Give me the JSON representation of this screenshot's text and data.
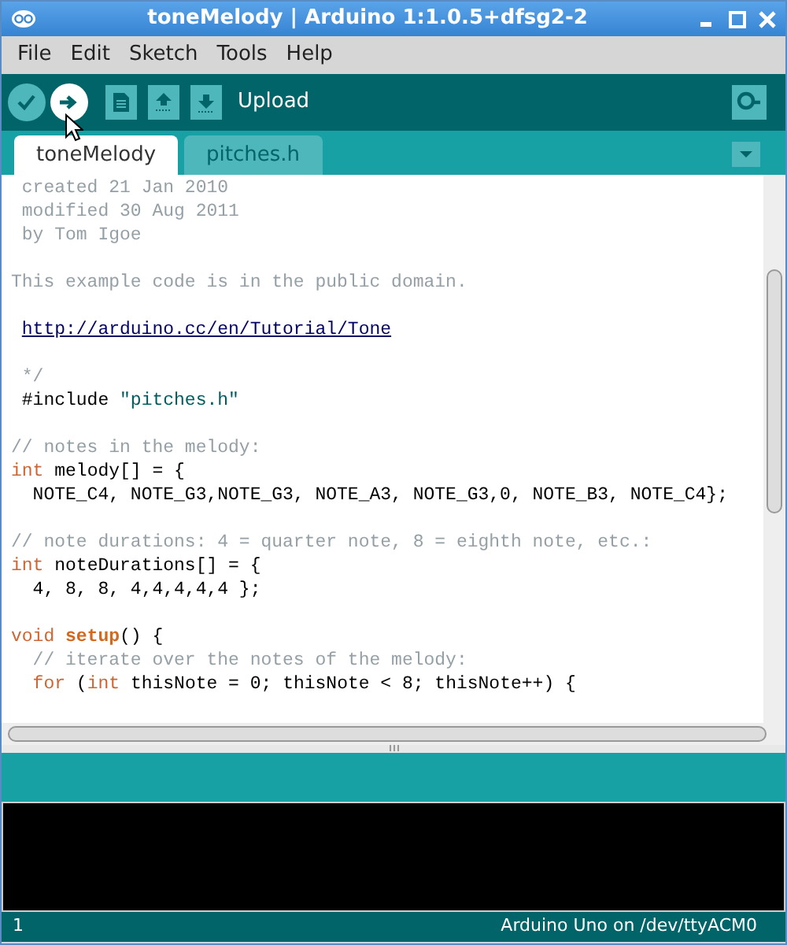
{
  "window": {
    "title": "toneMelody | Arduino 1:1.0.5+dfsg2-2"
  },
  "menu": [
    "File",
    "Edit",
    "Sketch",
    "Tools",
    "Help"
  ],
  "toolbar": {
    "buttons": [
      {
        "kind": "verify",
        "highlighted": false
      },
      {
        "kind": "upload",
        "highlighted": true
      },
      {
        "kind": "new",
        "highlighted": false
      },
      {
        "kind": "open",
        "highlighted": false
      },
      {
        "kind": "save",
        "highlighted": false
      }
    ],
    "hint": "Upload"
  },
  "tabs": [
    {
      "label": "toneMelody",
      "selected": true
    },
    {
      "label": "pitches.h",
      "selected": false
    }
  ],
  "editor": {
    "lines": [
      {
        "kind": "code",
        "tokens": [
          {
            "kind": "comment",
            "text": " created 21 Jan 2010"
          }
        ]
      },
      {
        "kind": "code",
        "tokens": [
          {
            "kind": "comment",
            "text": " modified 30 Aug 2011"
          }
        ]
      },
      {
        "kind": "code",
        "tokens": [
          {
            "kind": "comment",
            "text": " by Tom Igoe"
          }
        ]
      },
      {
        "kind": "blank"
      },
      {
        "kind": "code",
        "tokens": [
          {
            "kind": "comment",
            "text": "This example code is in the public domain."
          }
        ]
      },
      {
        "kind": "blank"
      },
      {
        "kind": "code",
        "tokens": [
          {
            "kind": "link",
            "text": "http://arduino.cc/en/Tutorial/Tone"
          }
        ]
      },
      {
        "kind": "blank"
      },
      {
        "kind": "code",
        "tokens": [
          {
            "kind": "comment",
            "text": " */"
          }
        ]
      },
      {
        "kind": "code",
        "tokens": [
          {
            "kind": "plain",
            "text": " #include "
          },
          {
            "kind": "string",
            "text": "\"pitches.h\""
          }
        ]
      },
      {
        "kind": "blank"
      },
      {
        "kind": "code",
        "tokens": [
          {
            "kind": "comment",
            "text": "// notes in the melody:"
          }
        ]
      },
      {
        "kind": "code",
        "tokens": [
          {
            "kind": "keyword",
            "text": "int"
          },
          {
            "kind": "plain",
            "text": " melody[] = {"
          }
        ]
      },
      {
        "kind": "code",
        "tokens": [
          {
            "kind": "plain",
            "text": "  NOTE_C4, NOTE_G3,NOTE_G3, NOTE_A3, NOTE_G3,0, NOTE_B3, NOTE_C4};"
          }
        ]
      },
      {
        "kind": "blank"
      },
      {
        "kind": "code",
        "tokens": [
          {
            "kind": "comment",
            "text": "// note durations: 4 = quarter note, 8 = eighth note, etc.:"
          }
        ]
      },
      {
        "kind": "code",
        "tokens": [
          {
            "kind": "keyword",
            "text": "int"
          },
          {
            "kind": "plain",
            "text": " noteDurations[] = {"
          }
        ]
      },
      {
        "kind": "code",
        "tokens": [
          {
            "kind": "plain",
            "text": "  4, 8, 8, 4,4,4,4,4 };"
          }
        ]
      },
      {
        "kind": "blank"
      },
      {
        "kind": "code",
        "tokens": [
          {
            "kind": "keyword",
            "text": "void "
          },
          {
            "kind": "function",
            "text": "setup"
          },
          {
            "kind": "plain",
            "text": "() {"
          }
        ]
      },
      {
        "kind": "code",
        "tokens": [
          {
            "kind": "comment",
            "text": "  // iterate over the notes of the melody:"
          }
        ]
      },
      {
        "kind": "code",
        "tokens": [
          {
            "kind": "keyword",
            "text": "  for"
          },
          {
            "kind": "plain",
            "text": " ("
          },
          {
            "kind": "keyword",
            "text": "int"
          },
          {
            "kind": "plain",
            "text": " thisNote = 0; thisNote < 8; thisNote++) {"
          }
        ]
      }
    ]
  },
  "status_bar": {
    "line": "1",
    "board": "Arduino Uno on /dev/ttyACM0"
  }
}
